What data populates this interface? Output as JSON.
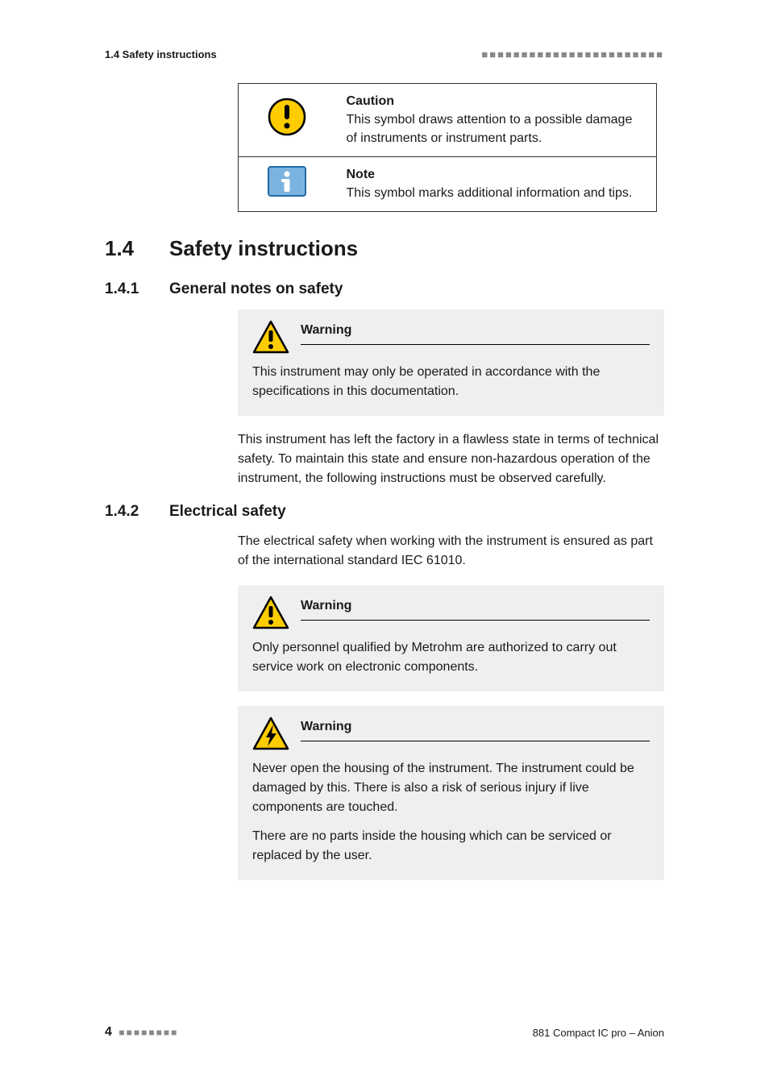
{
  "header": {
    "left": "1.4 Safety instructions",
    "right_dashes": "■■■■■■■■■■■■■■■■■■■■■■■"
  },
  "symbol_table": {
    "rows": [
      {
        "icon": "caution-round-icon",
        "title": "Caution",
        "text": "This symbol draws attention to a possible damage of instruments or instrument parts."
      },
      {
        "icon": "note-info-icon",
        "title": "Note",
        "text": "This symbol marks additional information and tips."
      }
    ]
  },
  "section14": {
    "num": "1.4",
    "title": "Safety instructions"
  },
  "section141": {
    "num": "1.4.1",
    "title": "General notes on safety",
    "warning1": {
      "label": "Warning",
      "text": "This instrument may only be operated in accordance with the specifications in this documentation."
    },
    "para": "This instrument has left the factory in a flawless state in terms of technical safety. To maintain this state and ensure non-hazardous operation of the instrument, the following instructions must be observed carefully."
  },
  "section142": {
    "num": "1.4.2",
    "title": "Electrical safety",
    "intro": "The electrical safety when working with the instrument is ensured as part of the international standard IEC 61010.",
    "warning1": {
      "label": "Warning",
      "text": "Only personnel qualified by Metrohm are authorized to carry out service work on electronic components."
    },
    "warning2": {
      "label": "Warning",
      "p1": "Never open the housing of the instrument. The instrument could be damaged by this. There is also a risk of serious injury if live components are touched.",
      "p2": "There are no parts inside the housing which can be serviced or replaced by the user."
    }
  },
  "footer": {
    "page_num": "4",
    "left_dashes": "■■■■■■■■",
    "right": "881 Compact IC pro – Anion"
  }
}
